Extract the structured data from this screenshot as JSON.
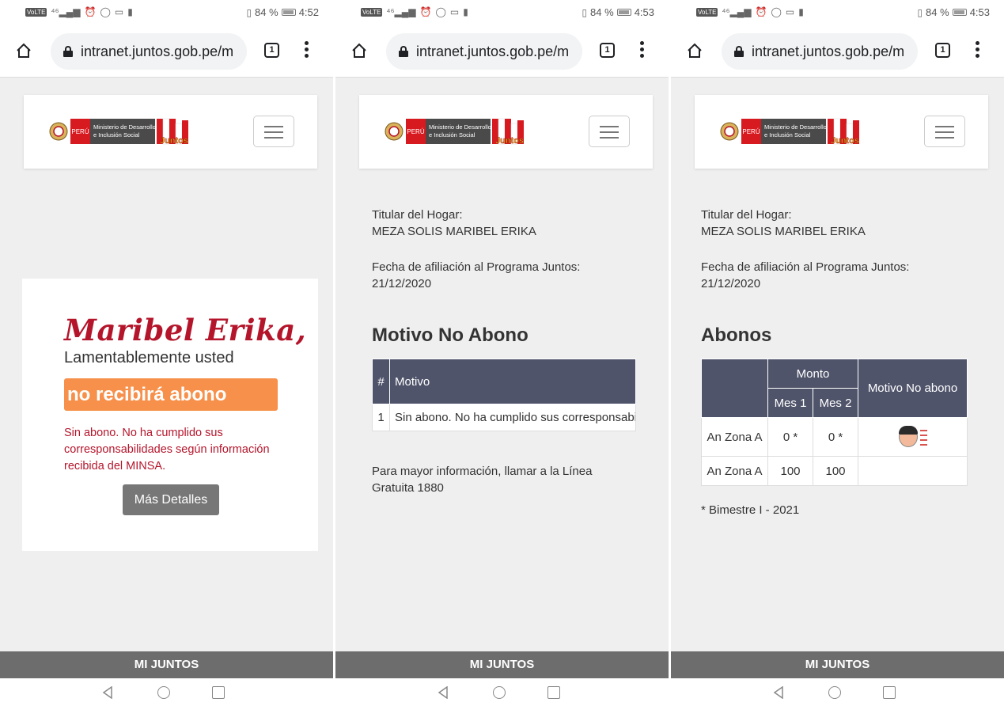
{
  "status_bar": {
    "panel1": {
      "battery": "84 %",
      "time": "4:52"
    },
    "panel2": {
      "battery": "84 %",
      "time": "4:53"
    },
    "panel3": {
      "battery": "84 %",
      "time": "4:53"
    }
  },
  "browser": {
    "url": "intranet.juntos.gob.pe/m",
    "tab_count": "1"
  },
  "header": {
    "peru": "PERÚ",
    "ministry_line1": "Ministerio de Desarrollo",
    "ministry_line2": "e Inclusión Social",
    "juntos": "Juntos"
  },
  "footer": {
    "label": "MI JUNTOS"
  },
  "panel1": {
    "name": "Maribel Erika,",
    "lamentablemente": "Lamentablemente usted",
    "no_abono": "no recibirá abono",
    "reason": "Sin abono. No ha cumplido sus corresponsabilidades según información recibida del MINSA.",
    "details_button": "Más Detalles"
  },
  "panel2": {
    "titular_label": "Titular del Hogar:",
    "titular_name": "MEZA SOLIS MARIBEL ERIKA",
    "fecha_label": "Fecha de afiliación al Programa Juntos:",
    "fecha_value": "21/12/2020",
    "section_title": "Motivo No Abono",
    "table_headers": [
      "#",
      "Motivo"
    ],
    "table_rows": [
      {
        "num": "1",
        "motivo": "Sin abono. No ha cumplido sus corresponsabilidades"
      }
    ],
    "more_info": "Para mayor información, llamar a la Línea Gratuita 1880"
  },
  "panel3": {
    "titular_label": "Titular del Hogar:",
    "titular_name": "MEZA SOLIS MARIBEL ERIKA",
    "fecha_label": "Fecha de afiliación al Programa Juntos:",
    "fecha_value": "21/12/2020",
    "section_title": "Abonos",
    "header_monto": "Monto",
    "header_mes1": "Mes 1",
    "header_mes2": "Mes 2",
    "header_motivo": "Motivo No abono",
    "rows": [
      {
        "zona": "An Zona A",
        "mes1": "0 *",
        "mes2": "0 *",
        "icon": "sad-child-icon"
      },
      {
        "zona": "An Zona A",
        "mes1": "100",
        "mes2": "100",
        "icon": ""
      }
    ],
    "footnote": "* Bimestre I - 2021"
  },
  "colors": {
    "accent_red": "#b5152b",
    "badge_orange": "#f7904a",
    "table_header": "#50546b",
    "footer_gray": "#6d6d6d"
  }
}
